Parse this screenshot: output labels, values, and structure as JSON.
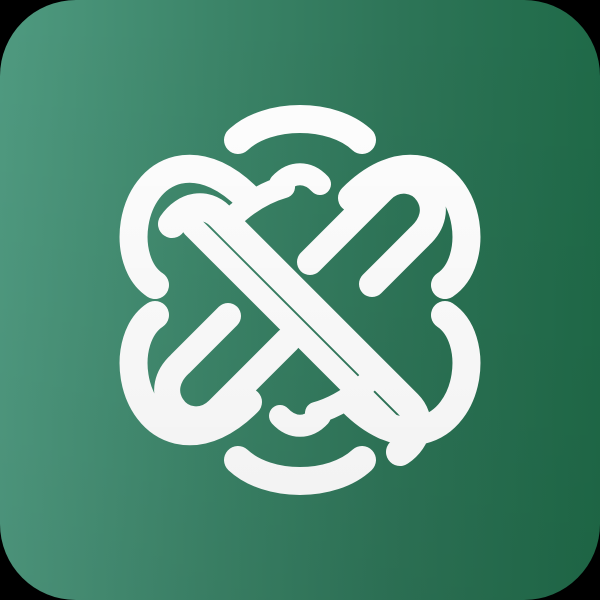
{
  "app_icon": {
    "name": "celtic-knot-app-icon",
    "background_gradient": [
      "#4f9a80",
      "#3c8569",
      "#2e7558",
      "#1f6a48"
    ],
    "logo_color": "#ffffff",
    "logo_icon": "celtic-knot-icon"
  },
  "page_background": "#000000"
}
